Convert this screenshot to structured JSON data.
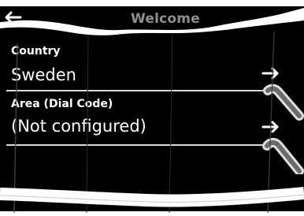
{
  "screen": {
    "title": "Welcome",
    "back_icon": "left-arrow-icon"
  },
  "rows": [
    {
      "label": "Country",
      "value": "Sweden",
      "arrow_icon": "right-arrow-icon"
    },
    {
      "label": "Area (Dial Code)",
      "value": "(Not configured)",
      "arrow_icon": "right-arrow-icon"
    }
  ],
  "colors": {
    "background": "#000000",
    "title": "#8f8f8f",
    "text": "#ffffff",
    "divider": "#d9d9d9"
  }
}
